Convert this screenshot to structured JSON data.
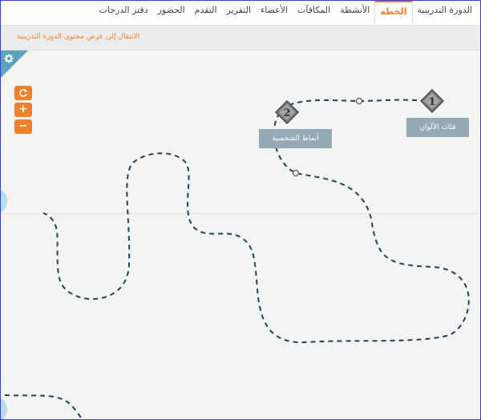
{
  "nav": {
    "tabs": [
      {
        "label": "الدورة التدريبية",
        "active": false
      },
      {
        "label": "الخطة",
        "active": true
      },
      {
        "label": "الأنشطة",
        "active": false
      },
      {
        "label": "المكافآت",
        "active": false
      },
      {
        "label": "الأعضاء",
        "active": false
      },
      {
        "label": "التقرير",
        "active": false
      },
      {
        "label": "التقدم",
        "active": false
      },
      {
        "label": "الحضور",
        "active": false
      },
      {
        "label": "دفتر الدرجات",
        "active": false
      }
    ]
  },
  "infobar": {
    "link_text": "الانتقال إلى عرض محتوى الدورة التدريبية"
  },
  "controls": {
    "refresh_icon": "refresh-icon",
    "zoom_in_label": "+",
    "zoom_out_label": "−",
    "settings_icon": "gear-icon"
  },
  "path_nodes": [
    {
      "number": "1",
      "title": "فئات الألوان"
    },
    {
      "number": "2",
      "title": "أنماط الشخصية"
    }
  ],
  "colors": {
    "accent": "#f0812a",
    "path": "#1e4258",
    "node_label_bg": "#94abb5",
    "corner": "#5aa3bd"
  }
}
